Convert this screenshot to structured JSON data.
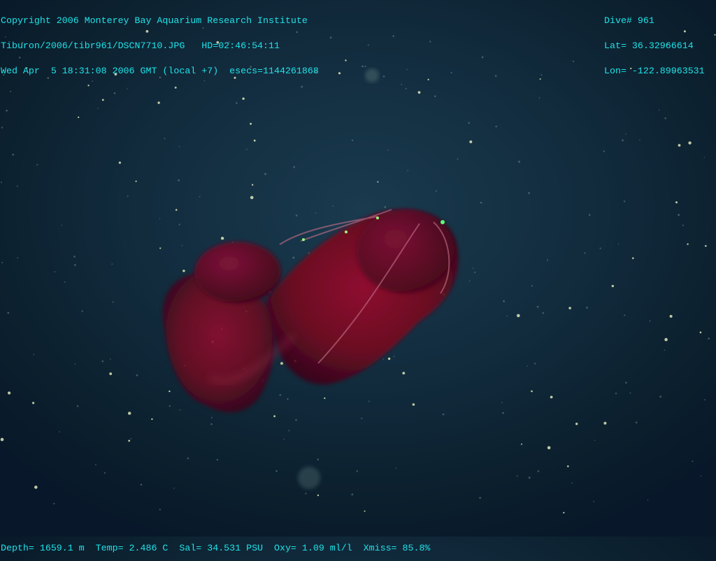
{
  "overlay": {
    "top_left": [
      "Copyright 2006 Monterey Bay Aquarium Research Institute",
      "Tiburon/2006/tibr961/DSCN7710.JPG   HD=02:46:54:11",
      "Wed Apr  5 18:31:08 2006 GMT (local +7)  esecs=1144261868"
    ],
    "top_right": [
      "Dive# 961",
      "Lat= 36.32966614",
      "Lon= -122.89963531"
    ],
    "bottom": "Depth= 1659.1 m  Temp= 2.486 C  Sal= 34.531 PSU  Oxy= 1.09 ml/l  Xmiss= 85.8%"
  },
  "colors": {
    "overlay_text": "#1fe3e8",
    "water": "#122c3e",
    "creature": "#7a0a22"
  }
}
